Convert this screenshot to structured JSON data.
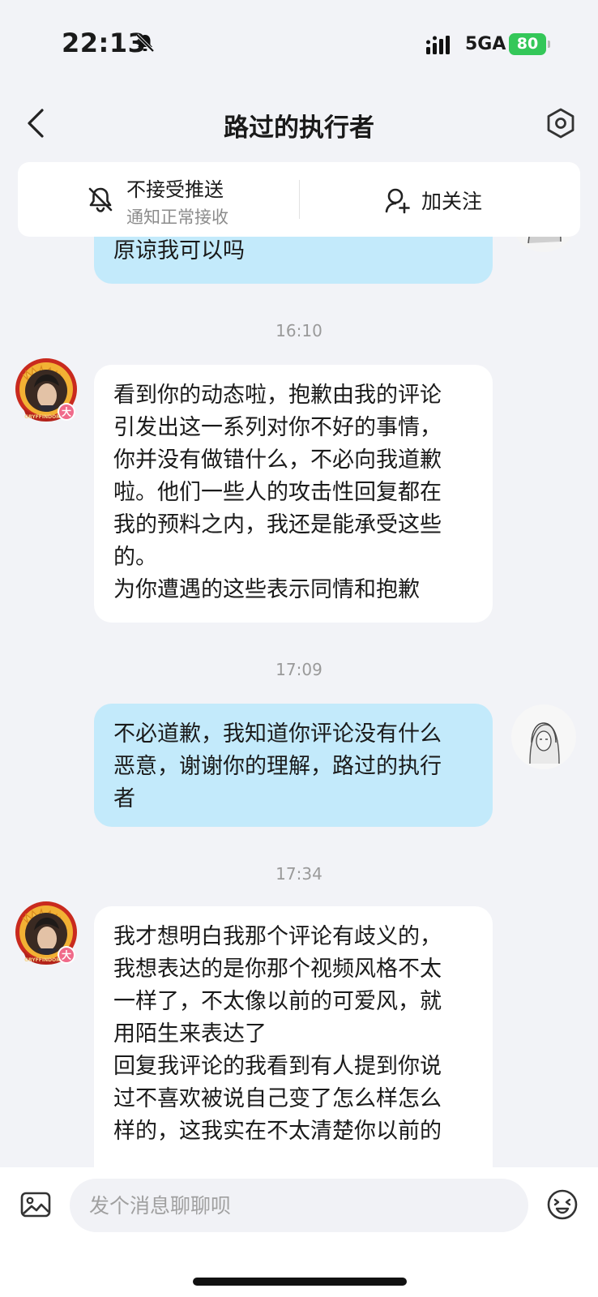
{
  "status": {
    "time": "22:13",
    "network": "5GA",
    "battery": "80"
  },
  "nav": {
    "title": "路过的执行者"
  },
  "subscribe": {
    "push_label": "不接受推送",
    "push_sub": "通知正常接收",
    "follow_label": "加关注"
  },
  "messages": [
    {
      "from": "me",
      "lines": [
        "原谅我可以吗"
      ]
    },
    {
      "timestamp": "16:10"
    },
    {
      "from": "them",
      "lines": [
        "看到你的动态啦，抱歉由我的评论",
        "引发出这一系列对你不好的事情，",
        "你并没有做错什么，不必向我道歉",
        "啦。他们一些人的攻击性回复都在",
        "我的预料之内，我还是能承受这些",
        "的。",
        "为你遭遇的这些表示同情和抱歉"
      ]
    },
    {
      "timestamp": "17:09"
    },
    {
      "from": "me",
      "lines": [
        "不必道歉，我知道你评论没有什么",
        "恶意，谢谢你的理解，路过的执行",
        "者"
      ]
    },
    {
      "timestamp": "17:34"
    },
    {
      "from": "them",
      "lines": [
        "我才想明白我那个评论有歧义的，",
        "我想表达的是你那个视频风格不太",
        "一样了，不太像以前的可爱风，就",
        "用陌生来表达了",
        "回复我评论的我看到有人提到你说",
        "过不喜欢被说自己变了怎么样怎么",
        "样的，这我实在不太清楚你以前的"
      ]
    }
  ],
  "avatar_badge": "大",
  "avatar_banner": "GRYFFINDOR",
  "input": {
    "placeholder": "发个消息聊聊呗"
  },
  "colors": {
    "mine_bubble": "#c3eafb",
    "their_bubble": "#ffffff",
    "background": "#f2f3f7",
    "battery": "#34c759"
  }
}
